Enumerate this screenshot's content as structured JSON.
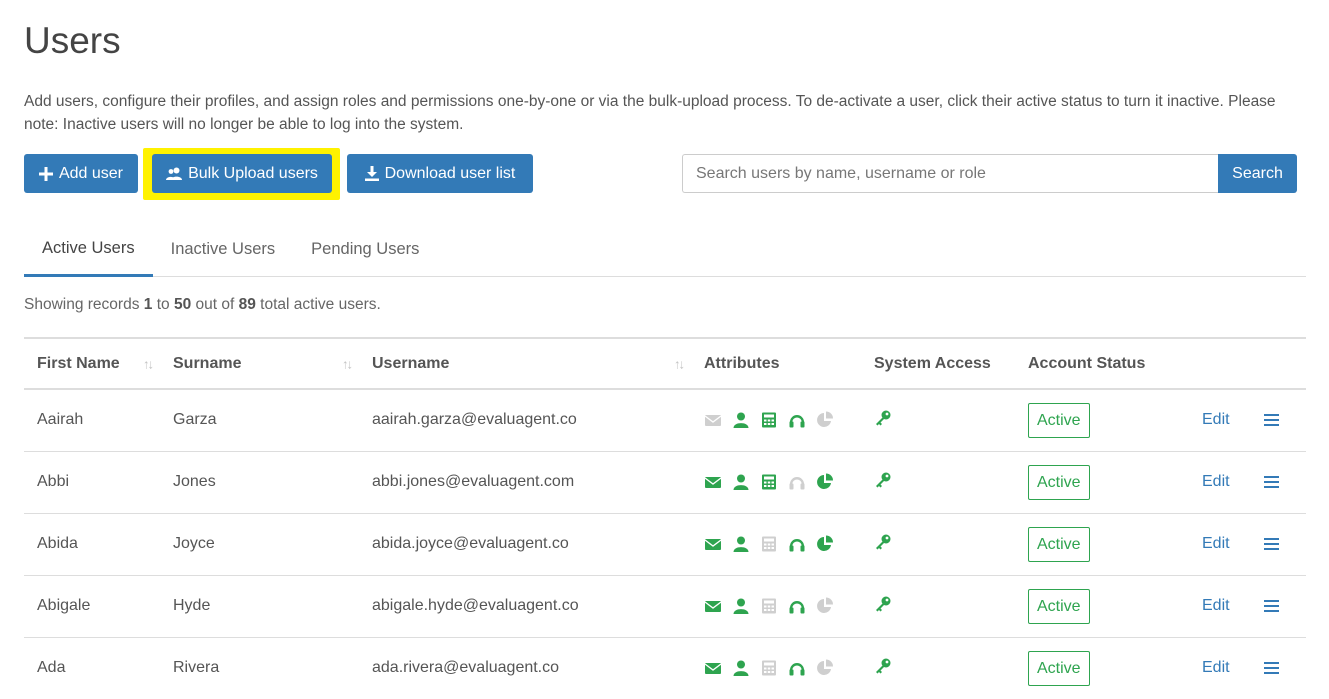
{
  "page": {
    "title": "Users",
    "description": "Add users, configure their profiles, and assign roles and permissions one-by-one or via the bulk-upload process. To de-activate a user, click their active status to turn it inactive. Please note: Inactive users will no longer be able to log into the system."
  },
  "toolbar": {
    "add_user_label": "Add user",
    "bulk_upload_label": "Bulk Upload users",
    "download_label": "Download user list",
    "search_placeholder": "Search users by name, username or role",
    "search_value": "",
    "search_button_label": "Search"
  },
  "tabs": [
    {
      "label": "Active Users",
      "active": true
    },
    {
      "label": "Inactive Users",
      "active": false
    },
    {
      "label": "Pending Users",
      "active": false
    }
  ],
  "records": {
    "prefix": "Showing records",
    "from": "1",
    "to_word": "to",
    "to": "50",
    "out_of_word": "out of",
    "total": "89",
    "suffix": "total active users."
  },
  "table": {
    "columns": [
      "First Name",
      "Surname",
      "Username",
      "Attributes",
      "System Access",
      "Account Status"
    ],
    "rows": [
      {
        "first": "Aairah",
        "surname": "Garza",
        "username": "aairah.garza@evaluagent.co",
        "attrs": [
          false,
          true,
          true,
          true,
          false
        ],
        "status": "Active",
        "edit": "Edit"
      },
      {
        "first": "Abbi",
        "surname": "Jones",
        "username": "abbi.jones@evaluagent.com",
        "attrs": [
          true,
          true,
          true,
          false,
          true
        ],
        "status": "Active",
        "edit": "Edit"
      },
      {
        "first": "Abida",
        "surname": "Joyce",
        "username": "abida.joyce@evaluagent.co",
        "attrs": [
          true,
          true,
          false,
          true,
          true
        ],
        "status": "Active",
        "edit": "Edit"
      },
      {
        "first": "Abigale",
        "surname": "Hyde",
        "username": "abigale.hyde@evaluagent.co",
        "attrs": [
          true,
          true,
          false,
          true,
          false
        ],
        "status": "Active",
        "edit": "Edit"
      },
      {
        "first": "Ada",
        "surname": "Rivera",
        "username": "ada.rivera@evaluagent.co",
        "attrs": [
          true,
          true,
          false,
          true,
          false
        ],
        "status": "Active",
        "edit": "Edit"
      }
    ]
  },
  "icons": {
    "attributes": [
      "envelope-icon",
      "user-icon",
      "calculator-icon",
      "headset-icon",
      "chart-pie-icon"
    ],
    "system_access": "key-icon",
    "row_menu": "hamburger-menu-icon"
  },
  "colors": {
    "primary": "#337ab7",
    "highlight": "#fff200",
    "attribute_on": "#2ea44f",
    "attribute_off": "#cfcfcf"
  }
}
